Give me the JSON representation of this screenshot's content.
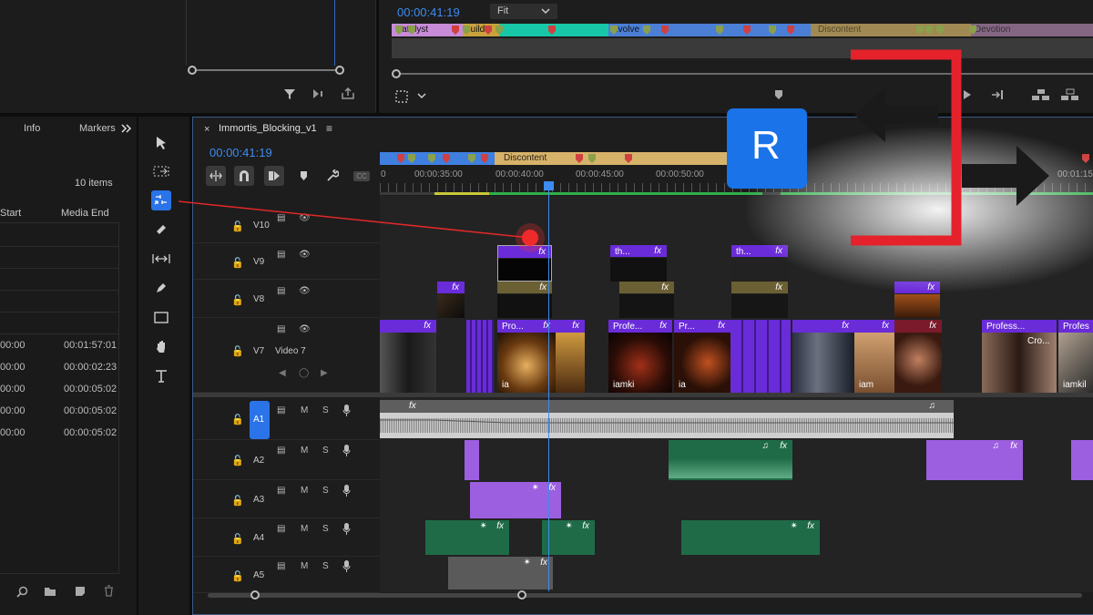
{
  "program": {
    "timecode": "00:00:41:19",
    "zoom": "Fit",
    "segments": [
      {
        "label": "Catalyst",
        "color": "#c78bd8"
      },
      {
        "label": "Build",
        "color": "#c9a23c"
      },
      {
        "label": "",
        "color": "#17c7a8"
      },
      {
        "label": "Evolve",
        "color": "#4b7fd6"
      },
      {
        "label": "Discontent",
        "color": "#d8b86a"
      },
      {
        "label": "Devotion",
        "color": "#c998c8"
      }
    ]
  },
  "project": {
    "tabs": [
      "Info",
      "Markers"
    ],
    "more_icon": "double-chevron-icon",
    "item_count": "10 items",
    "col_start": "Start",
    "col_media_end": "Media End",
    "rows": [
      {
        "start": "00:00",
        "end": "00:01:57:01"
      },
      {
        "start": "00:00",
        "end": "00:00:02:23"
      },
      {
        "start": "00:00",
        "end": "00:00:05:02"
      },
      {
        "start": "00:00",
        "end": "00:00:05:02"
      },
      {
        "start": "00:00",
        "end": "00:00:05:02"
      }
    ]
  },
  "timeline": {
    "sequence_name": "Immortis_Blocking_v1",
    "close": "×",
    "menu": "≡",
    "timecode": "00:00:41:19",
    "ruler": [
      "0",
      "00:00:35:00",
      "00:00:40:00",
      "00:00:45:00",
      "00:00:50:00",
      "00:01:15"
    ],
    "marker_segment": "Discontent",
    "video_tracks": [
      {
        "id": "V10",
        "name": ""
      },
      {
        "id": "V9",
        "name": ""
      },
      {
        "id": "V8",
        "name": ""
      },
      {
        "id": "V7",
        "name": "Video 7"
      }
    ],
    "audio_tracks": [
      "A1",
      "A2",
      "A3",
      "A4",
      "A5"
    ],
    "m": "M",
    "s": "S",
    "fx": "fx",
    "clips_v9": [
      "th...",
      "th..."
    ],
    "clips_v7": [
      "Pro...",
      "Profe...",
      "Pr...",
      "Profess...",
      "Profes",
      "Cro..."
    ],
    "clips_v7_bottom": [
      "ia",
      "iamki",
      "ia",
      "iam",
      "iamkil"
    ]
  },
  "overlay": {
    "key_letter": "R",
    "key_color": "#1a73e8",
    "bracket_color": "#e5222b"
  },
  "colors": {
    "accent": "#2b73e8",
    "timecode_blue": "#3d8cf0"
  }
}
